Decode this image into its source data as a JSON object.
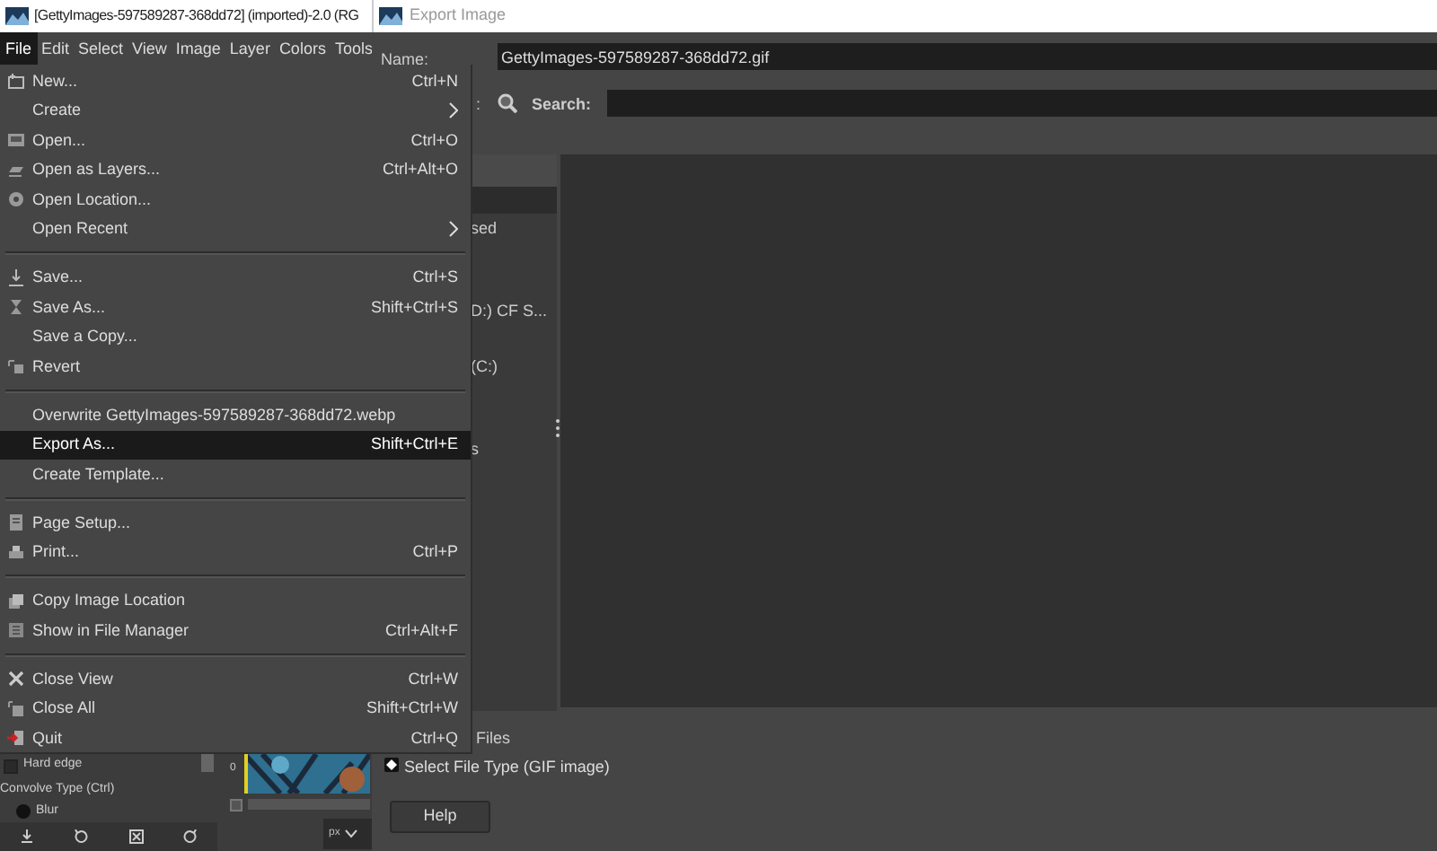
{
  "gimp_window": {
    "title": "[GettyImages-597589287-368dd72] (imported)-2.0 (RG",
    "menubar": [
      {
        "label": "File",
        "selected": true
      },
      {
        "label": "Edit",
        "selected": false
      },
      {
        "label": "Select",
        "selected": false
      },
      {
        "label": "View",
        "selected": false
      },
      {
        "label": "Image",
        "selected": false
      },
      {
        "label": "Layer",
        "selected": false
      },
      {
        "label": "Colors",
        "selected": false
      },
      {
        "label": "Tools",
        "selected": false
      }
    ],
    "tool_options": {
      "hard_edge": {
        "label": "Hard edge",
        "checked": false
      },
      "convolve_label": "Convolve Type  (Ctrl)",
      "blur": {
        "label": "Blur",
        "selected": true
      }
    },
    "ruler_label": "0",
    "quick_mask": {
      "checked": false
    },
    "unit": "px"
  },
  "export_dialog": {
    "title": "Export Image",
    "name_label": "Name:",
    "name_value": "GettyImages-597589287-368dd72.gif",
    "folder_label_fragment": ":",
    "search_label": "Search:",
    "places": [
      {
        "label": "sed"
      },
      {
        "label": "D:) CF S..."
      },
      {
        "label": "(C:)"
      },
      {
        "label": "s"
      }
    ],
    "files_fragment": "Files",
    "file_type_label": "Select File Type (GIF image)",
    "help_button": "Help"
  },
  "file_menu": [
    {
      "kind": "item",
      "label": "New...",
      "shortcut": "Ctrl+N",
      "highlighted": false
    },
    {
      "kind": "submenu",
      "label": "Create",
      "highlighted": false
    },
    {
      "kind": "item",
      "label": "Open...",
      "shortcut": "Ctrl+O",
      "highlighted": false
    },
    {
      "kind": "item",
      "label": "Open as Layers...",
      "shortcut": "Ctrl+Alt+O",
      "highlighted": false
    },
    {
      "kind": "item",
      "label": "Open Location...",
      "highlighted": false
    },
    {
      "kind": "submenu",
      "label": "Open Recent",
      "highlighted": false
    },
    {
      "kind": "separator"
    },
    {
      "kind": "item",
      "label": "Save...",
      "shortcut": "Ctrl+S",
      "highlighted": false
    },
    {
      "kind": "item",
      "label": "Save As...",
      "shortcut": "Shift+Ctrl+S",
      "highlighted": false
    },
    {
      "kind": "item",
      "label": "Save a Copy...",
      "highlighted": false
    },
    {
      "kind": "item",
      "label": "Revert",
      "highlighted": false
    },
    {
      "kind": "separator"
    },
    {
      "kind": "item",
      "label": "Overwrite GettyImages-597589287-368dd72.webp",
      "highlighted": false
    },
    {
      "kind": "item",
      "label": "Export As...",
      "shortcut": "Shift+Ctrl+E",
      "highlighted": true
    },
    {
      "kind": "item",
      "label": "Create Template...",
      "highlighted": false
    },
    {
      "kind": "separator"
    },
    {
      "kind": "item",
      "label": "Page Setup...",
      "highlighted": false
    },
    {
      "kind": "item",
      "label": "Print...",
      "shortcut": "Ctrl+P",
      "highlighted": false
    },
    {
      "kind": "separator"
    },
    {
      "kind": "item",
      "label": "Copy Image Location",
      "highlighted": false
    },
    {
      "kind": "item",
      "label": "Show in File Manager",
      "shortcut": "Ctrl+Alt+F",
      "highlighted": false
    },
    {
      "kind": "separator"
    },
    {
      "kind": "item",
      "label": "Close View",
      "shortcut": "Ctrl+W",
      "highlighted": false
    },
    {
      "kind": "item",
      "label": "Close All",
      "shortcut": "Shift+Ctrl+W",
      "highlighted": false
    },
    {
      "kind": "item",
      "label": "Quit",
      "shortcut": "Ctrl+Q",
      "highlighted": false
    }
  ]
}
